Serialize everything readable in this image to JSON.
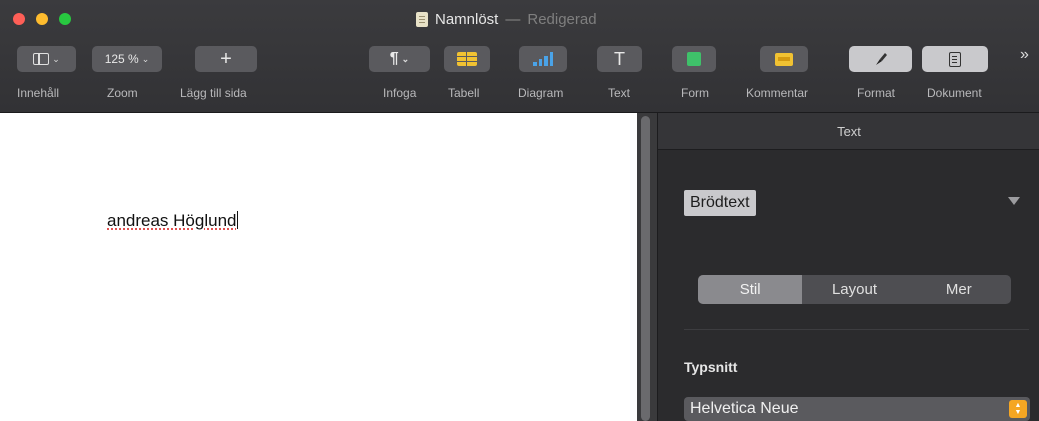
{
  "window": {
    "title": "Namnlöst",
    "separator": "—",
    "status": "Redigerad"
  },
  "toolbar": {
    "view_label": "Innehåll",
    "zoom_value": "125 %",
    "zoom_label": "Zoom",
    "add_page_icon_text": "+",
    "add_page_label": "Lägg till sida",
    "insert_icon_text": "¶",
    "insert_label": "Infoga",
    "table_label": "Tabell",
    "chart_label": "Diagram",
    "text_icon_text": "T",
    "text_label": "Text",
    "shape_label": "Form",
    "comment_label": "Kommentar",
    "format_label": "Format",
    "document_label": "Dokument",
    "more_text": "»"
  },
  "document": {
    "content": "andreas Höglund"
  },
  "sidebar": {
    "header": "Text",
    "paragraph_style": "Brödtext",
    "tabs": [
      "Stil",
      "Layout",
      "Mer"
    ],
    "font_label": "Typsnitt",
    "font_value": "Helvetica Neue"
  },
  "colors": {
    "accent": "#f5a623",
    "background": "#2b2b2d",
    "page": "#ffffff"
  }
}
